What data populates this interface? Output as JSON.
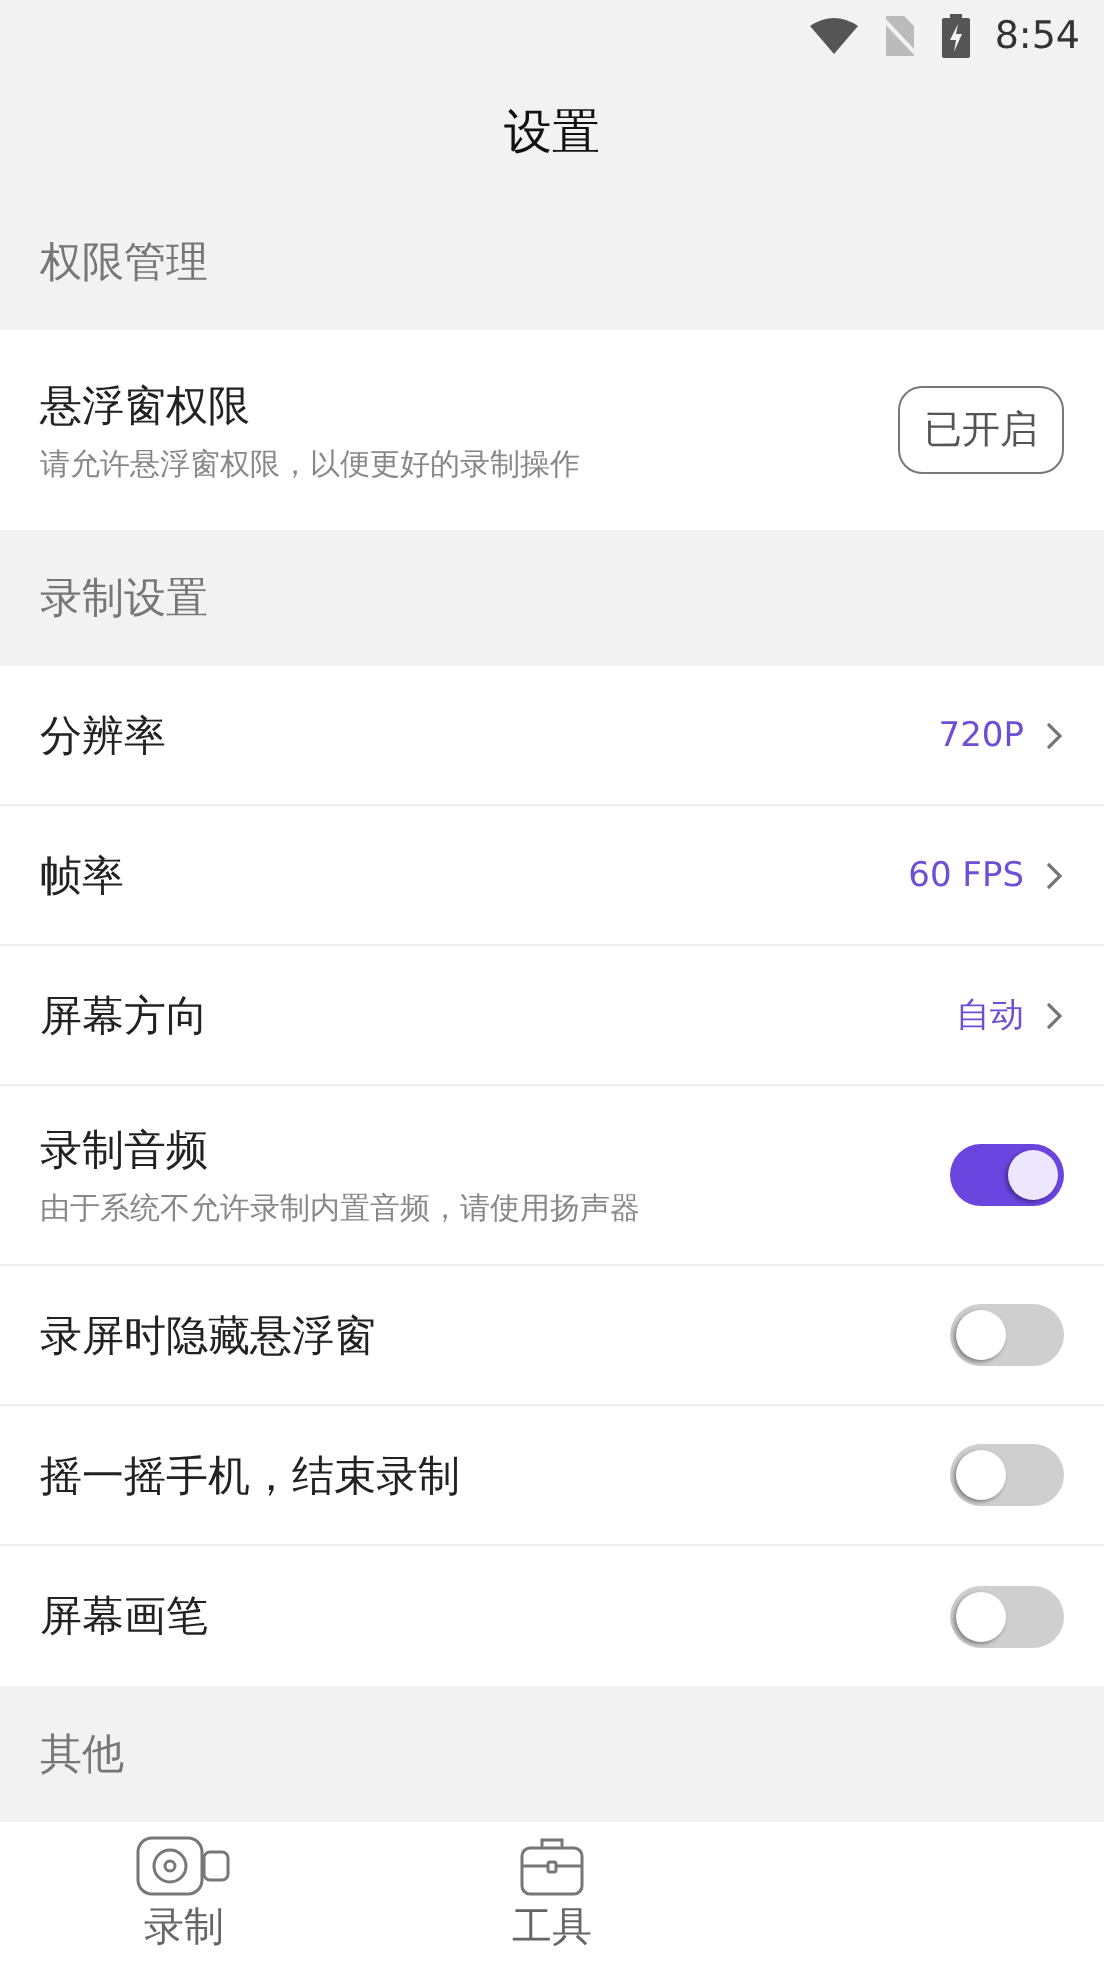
{
  "status_bar": {
    "time": "8:54"
  },
  "title": "设置",
  "sections": [
    {
      "header": "权限管理",
      "rows": [
        {
          "kind": "button",
          "title": "悬浮窗权限",
          "subtitle": "请允许悬浮窗权限，以便更好的录制操作",
          "button": "已开启"
        }
      ]
    },
    {
      "header": "录制设置",
      "rows": [
        {
          "kind": "value",
          "title": "分辨率",
          "value": "720P"
        },
        {
          "kind": "value",
          "title": "帧率",
          "value": "60 FPS"
        },
        {
          "kind": "value",
          "title": "屏幕方向",
          "value": "自动"
        },
        {
          "kind": "toggle",
          "title": "录制音频",
          "subtitle": "由于系统不允许录制内置音频，请使用扬声器",
          "on": true
        },
        {
          "kind": "toggle",
          "title": "录屏时隐藏悬浮窗",
          "on": false
        },
        {
          "kind": "toggle",
          "title": "摇一摇手机，结束录制",
          "on": false
        },
        {
          "kind": "toggle",
          "title": "屏幕画笔",
          "on": false
        }
      ]
    },
    {
      "header": "其他"
    }
  ],
  "bottom_nav": [
    {
      "kind": "record",
      "label": "录制"
    },
    {
      "kind": "tools",
      "label": "工具"
    }
  ]
}
